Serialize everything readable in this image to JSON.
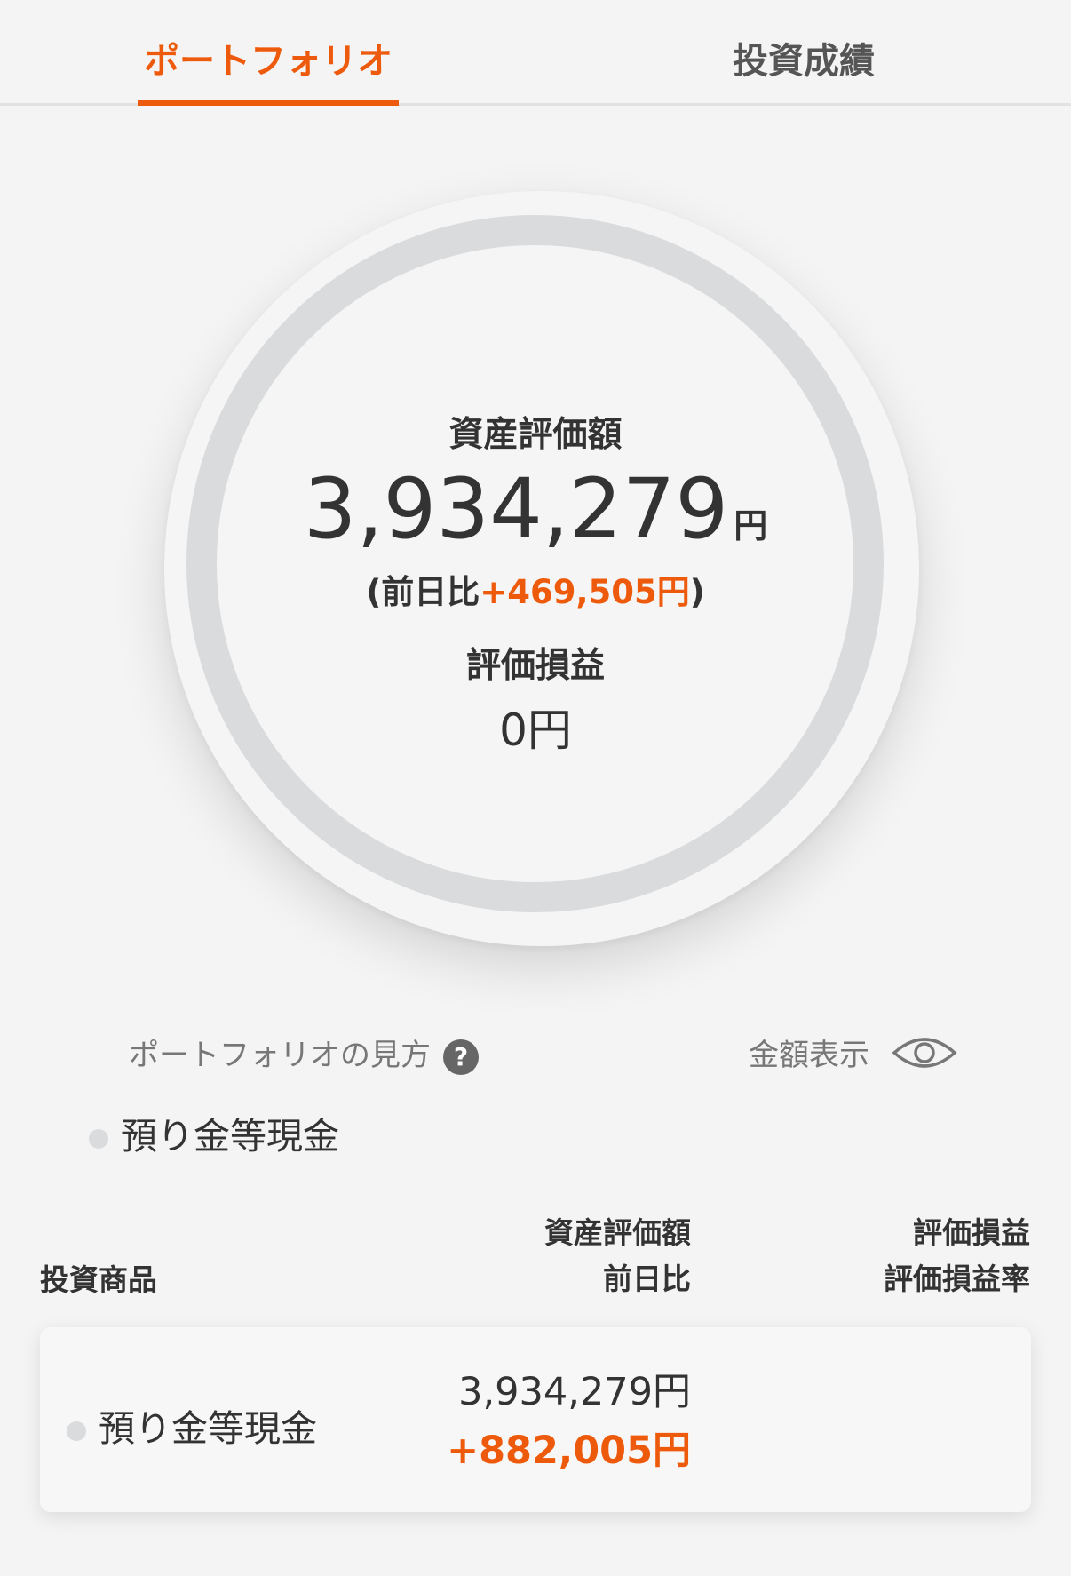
{
  "tabs": {
    "portfolio": "ポートフォリオ",
    "performance": "投資成績"
  },
  "summary": {
    "total_label": "資産評価額",
    "total_value": "3,934,279",
    "total_unit": "円",
    "change_prefix": "(前日比",
    "change_value": "+469,505円",
    "change_suffix": ")",
    "pl_label": "評価損益",
    "pl_value": "0円"
  },
  "controls": {
    "howto_label": "ポートフォリオの見方",
    "help_glyph": "?",
    "amount_label": "金額表示",
    "help_icon": "question-circle-icon",
    "amount_icon": "eye-icon"
  },
  "legend": [
    {
      "label": "預り金等現金",
      "color": "#dadbdd"
    }
  ],
  "table": {
    "headers": {
      "product": "投資商品",
      "eval_line1": "資産評価額",
      "eval_line2": "前日比",
      "pl_line1": "評価損益",
      "pl_line2": "評価損益率"
    },
    "rows": [
      {
        "name": "預り金等現金",
        "eval": "3,934,279円",
        "change": "+882,005円",
        "color": "#dadbdd"
      }
    ]
  },
  "colors": {
    "accent": "#ee5a0c",
    "ring": "#dadbdd",
    "background": "#f4f4f4"
  }
}
